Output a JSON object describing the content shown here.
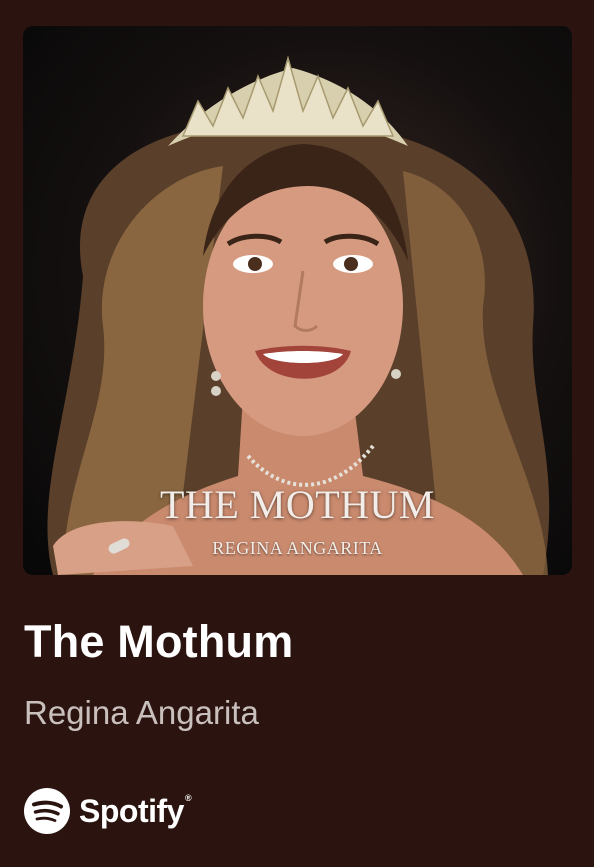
{
  "cover": {
    "title": "THE MOTHUM",
    "subtitle": "REGINA ANGARITA"
  },
  "track": {
    "title": "The Mothum",
    "artist": "Regina Angarita"
  },
  "brand": {
    "name": "Spotify",
    "icon": "spotify-logo-icon"
  },
  "colors": {
    "background": "#2b1410",
    "title": "#ffffff",
    "artist": "#c9c0bd"
  }
}
